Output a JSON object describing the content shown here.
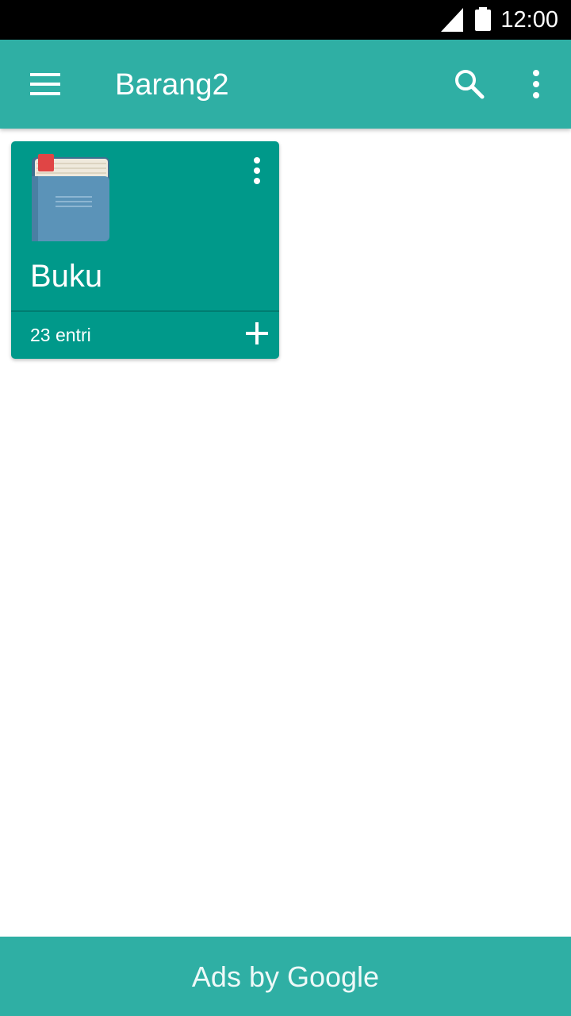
{
  "status_bar": {
    "time": "12:00",
    "icons": [
      "signal-icon",
      "battery-icon"
    ]
  },
  "app_bar": {
    "title": "Barang2",
    "icons": [
      "menu-icon",
      "search-icon",
      "overflow-menu-icon"
    ]
  },
  "collections": [
    {
      "title": "Buku",
      "count_label": "23 entri",
      "icon": "book-icon",
      "color": "#00998a"
    }
  ],
  "ad_banner": {
    "text": "Ads by Google"
  },
  "colors": {
    "primary": "#2fafa4",
    "card": "#00998a",
    "status_bar": "#000000",
    "bookmark": "#e04545",
    "book_cover": "#5b93b8"
  }
}
